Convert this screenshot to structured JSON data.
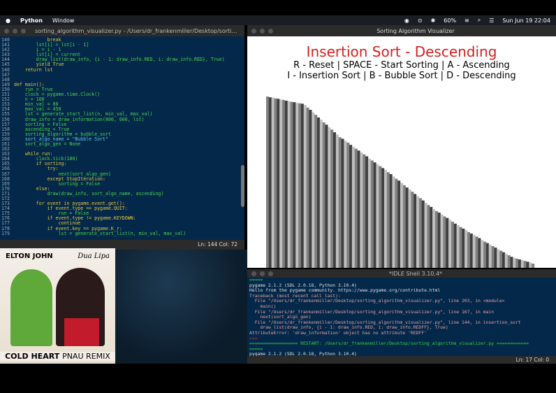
{
  "menubar": {
    "app": "Python",
    "items": [
      "Window"
    ],
    "battery": "60%",
    "datetime": "Sun Jun 19  22:04"
  },
  "editor": {
    "title": "sorting_algorithm_visualizer.py - /Users/dr_frankenmiller/Desktop/sorting_algorithm_...",
    "status": "Ln: 144  Col: 72",
    "lines": [
      [
        "140",
        "            break"
      ],
      [
        "141",
        "        lst[i] = lst[i - 1]"
      ],
      [
        "142",
        "        i = i - 1"
      ],
      [
        "143",
        "        lst[i] = current"
      ],
      [
        "144",
        "        draw_list(draw_info, {i - 1: draw_info.RED, i: draw_info.RED}, True)"
      ],
      [
        "145",
        "        yield True"
      ],
      [
        "146",
        "    return lst"
      ],
      [
        "147",
        ""
      ],
      [
        "148",
        ""
      ],
      [
        "149",
        "def main():"
      ],
      [
        "150",
        "    run = True"
      ],
      [
        "151",
        "    clock = pygame.time.Clock()"
      ],
      [
        "152",
        "    n = 100"
      ],
      [
        "153",
        "    min_val = 00"
      ],
      [
        "154",
        "    max_val = 450"
      ],
      [
        "155",
        "    lst = generate_start_list(n, min_val, max_val)"
      ],
      [
        "156",
        "    draw_info = draw_information(800, 600, lst)"
      ],
      [
        "157",
        "    sorting = False"
      ],
      [
        "158",
        "    ascending = True"
      ],
      [
        "159",
        "    sorting_algorithm = bubble_sort"
      ],
      [
        "160",
        "    sort_algo_name = \"Bubble Sort\""
      ],
      [
        "161",
        "    sort_algo_gen = None"
      ],
      [
        "162",
        ""
      ],
      [
        "163",
        "    while run:"
      ],
      [
        "164",
        "        clock.tick(180)"
      ],
      [
        "165",
        "        if sorting:"
      ],
      [
        "166",
        "            try:"
      ],
      [
        "167",
        "                next(sort_algo_gen)"
      ],
      [
        "168",
        "            except StopIteration:"
      ],
      [
        "169",
        "                sorting = False"
      ],
      [
        "170",
        "        else:"
      ],
      [
        "171",
        "            draw(draw_info, sort_algo_name, ascending)"
      ],
      [
        "172",
        ""
      ],
      [
        "173",
        "        for event in pygame.event.get():"
      ],
      [
        "174",
        "            if event.type == pygame.QUIT:"
      ],
      [
        "175",
        "                run = False"
      ],
      [
        "176",
        "            if event.type != pygame.KEYDOWN:"
      ],
      [
        "177",
        "                continue"
      ],
      [
        "178",
        "            if event.key == pygame.K_r:"
      ],
      [
        "179",
        "                lst = generate_start_list(n, min_val, max_val)"
      ]
    ]
  },
  "visualizer": {
    "window_title": "Sorting Algorithm Visualizer",
    "heading": "Insertion Sort - Descending",
    "controls1": "R - Reset | SPACE - Start Sorting | A - Ascending",
    "controls2": "I - Insertion Sort | B - Bubble Sort | D - Descending",
    "bar_colors": [
      "#808080",
      "#a0a0a0",
      "#c0c0c0",
      "#404040",
      "#202020"
    ],
    "values": [
      450,
      448,
      447,
      445,
      444,
      442,
      441,
      439,
      438,
      436,
      435,
      433,
      432,
      431,
      428,
      421,
      415,
      408,
      402,
      395,
      389,
      382,
      376,
      369,
      363,
      356,
      350,
      343,
      339,
      334,
      329,
      323,
      318,
      313,
      308,
      303,
      298,
      293,
      287,
      282,
      277,
      272,
      267,
      262,
      257,
      251,
      246,
      240,
      234,
      229,
      223,
      217,
      211,
      206,
      200,
      194,
      188,
      183,
      177,
      171,
      165,
      160,
      154,
      149,
      145,
      140,
      135,
      131,
      126,
      121,
      116,
      112,
      107,
      103,
      99,
      94,
      90,
      86,
      82,
      78,
      73,
      69,
      65,
      61,
      57,
      53,
      49,
      45,
      41,
      37,
      33,
      29,
      26,
      24,
      22,
      20,
      18,
      16,
      14,
      11
    ],
    "max": 450
  },
  "shell": {
    "title": "*IDLE Shell 3.10.4*",
    "status": "Ln: 17  Col: 0",
    "lines": [
      [
        "grn",
        "====="
      ],
      [
        "",
        "pygame 2.1.2 (SDL 2.0.18, Python 3.10.4)"
      ],
      [
        "",
        "Hello from the pygame community. https://www.pygame.org/contribute.html"
      ],
      [
        "err",
        "Traceback (most recent call last):"
      ],
      [
        "err",
        "  File \"/Users/dr_frankenmiller/Desktop/sorting_algorithm_visualizer.py\", line 203, in <module>"
      ],
      [
        "err",
        "    main()"
      ],
      [
        "err",
        "  File \"/Users/dr_frankenmiller/Desktop/sorting_algorithm_visualizer.py\", line 167, in main"
      ],
      [
        "err",
        "    next(sort_algo_gen)"
      ],
      [
        "err",
        "  File \"/Users/dr_frankenmiller/Desktop/sorting_algorithm_visualizer.py\", line 144, in insertion_sort"
      ],
      [
        "err",
        "    draw_list(draw_info, {i - 1: draw_info.RED, i: draw_info.REDFF}, True)"
      ],
      [
        "err",
        "AttributeError: 'draw_information' object has no attribute 'REDFF'"
      ],
      [
        "prompt",
        ">>>"
      ],
      [
        "grn",
        "================== RESTART: /Users/dr_frankenmiller/Desktop/sorting_algorithm_visualizer.py ============"
      ],
      [
        "grn",
        "====="
      ],
      [
        "",
        "pygame 2.1.2 (SDL 2.0.18, Python 3.10.4)"
      ]
    ]
  },
  "album": {
    "artist1": "ELTON JOHN",
    "artist2": "Dua Lipa",
    "title": "COLD HEART",
    "subtitle": "PNAU REMIX"
  }
}
